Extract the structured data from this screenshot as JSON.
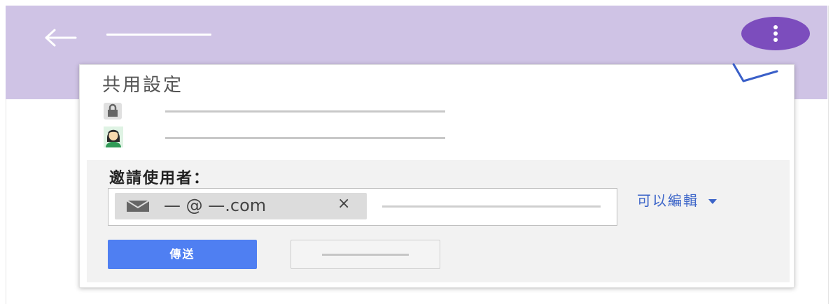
{
  "appbar": {
    "back_icon": "arrow-left-icon",
    "more_icon": "more-vert-icon",
    "annotation_icon": "pointer-arrow-icon"
  },
  "dialog": {
    "title": "共用設定",
    "rows": [
      {
        "icon": "lock-icon"
      },
      {
        "icon": "avatar-icon"
      }
    ],
    "invite": {
      "label": "邀請使用者：",
      "chip": {
        "icon": "mail-icon",
        "text": "— @ —.com",
        "close": "×"
      },
      "permission": "可以編輯",
      "send_label": "傳送"
    }
  },
  "colors": {
    "appbar": "#cfc3e5",
    "more_button": "#7c4dbd",
    "accent": "#4f7ff2",
    "link": "#3b64c8"
  }
}
